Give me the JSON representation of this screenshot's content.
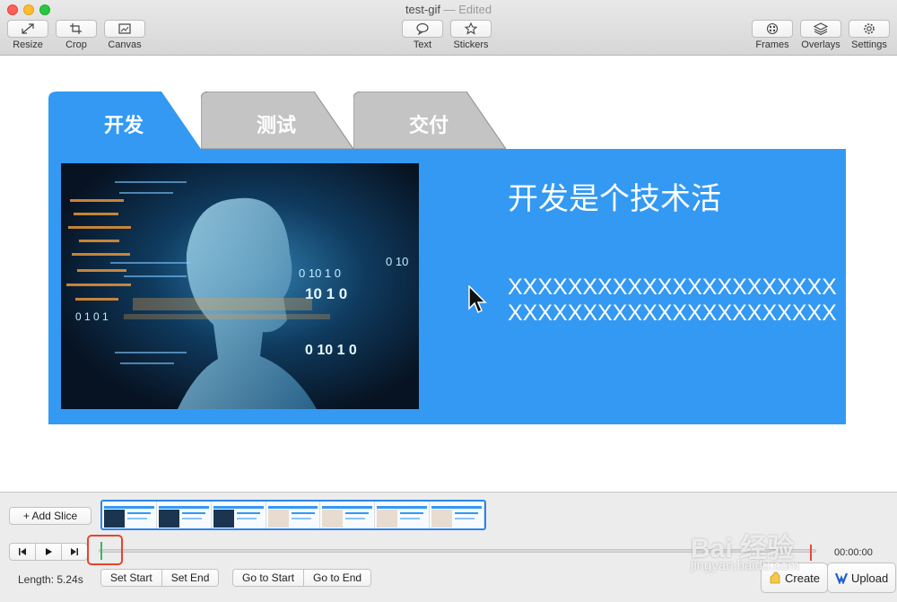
{
  "window": {
    "title": "test-gif",
    "separator": " — ",
    "status": "Edited"
  },
  "toolbar": {
    "left": [
      {
        "label": "Resize",
        "icon": "resize-icon"
      },
      {
        "label": "Crop",
        "icon": "crop-icon"
      },
      {
        "label": "Canvas",
        "icon": "canvas-icon"
      }
    ],
    "center": [
      {
        "label": "Text",
        "icon": "speech-bubble-icon"
      },
      {
        "label": "Stickers",
        "icon": "star-icon"
      }
    ],
    "right": [
      {
        "label": "Frames",
        "icon": "frames-icon"
      },
      {
        "label": "Overlays",
        "icon": "layers-icon"
      },
      {
        "label": "Settings",
        "icon": "gear-icon"
      }
    ]
  },
  "slide": {
    "tabs": [
      "开发",
      "测试",
      "交付"
    ],
    "active_tab": 0,
    "title": "开发是个技术活",
    "body": "XXXXXXXXXXXXXXXXXXXXXXXXXXXXXXXXXXXXXXXXXXXX",
    "photo_digits": [
      "0 10 1 0",
      "0 10",
      "10 1 0",
      "0 1 0 1",
      "0 10 1 0"
    ],
    "colors": {
      "accent": "#3399f3",
      "inactive_tab": "#c4c4c4"
    }
  },
  "timeline": {
    "add_slice_label": "+ Add Slice",
    "frame_count": 7,
    "time_readout": "00:00:00",
    "length_label": "Length: 5.24s",
    "set_buttons": [
      "Set Start",
      "Set End"
    ],
    "go_buttons": [
      "Go to Start",
      "Go to End"
    ],
    "create_label": "Create",
    "upload_label": "Upload",
    "playhead_progress": 0.0
  },
  "watermark": {
    "line1": "Bai 经验",
    "line2": "jingyan.baidu.com"
  }
}
